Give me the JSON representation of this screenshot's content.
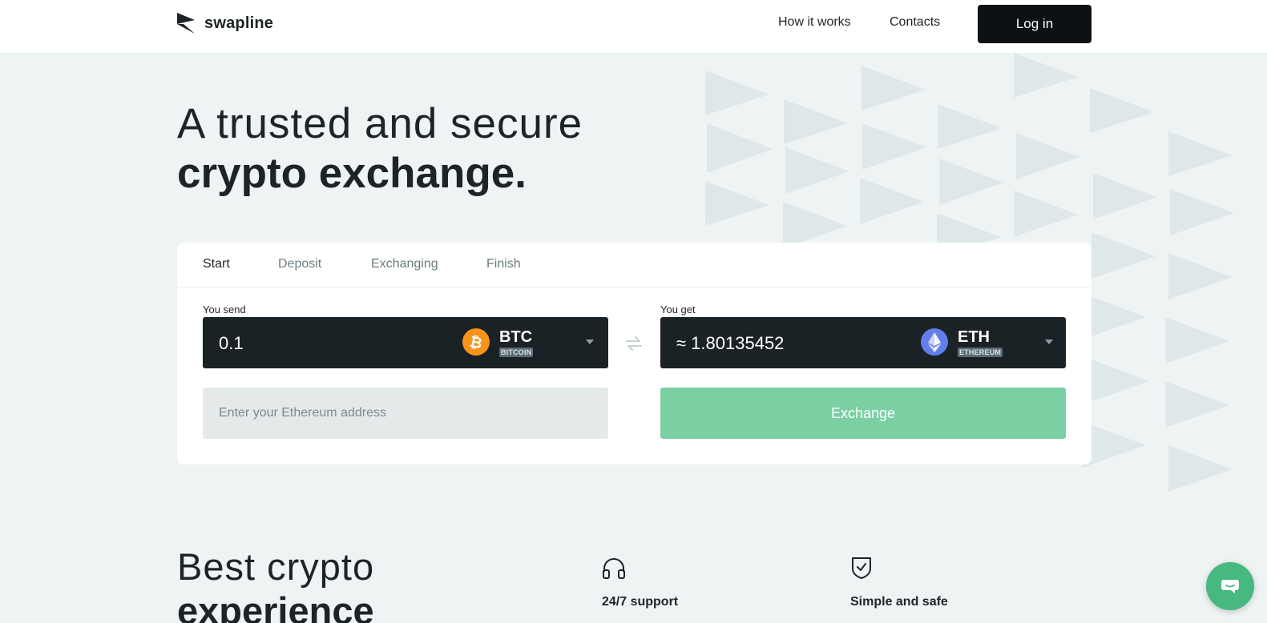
{
  "header": {
    "logo_text": "swapline",
    "nav": [
      {
        "label": "How it works"
      },
      {
        "label": "Contacts"
      }
    ],
    "login_label": "Log in"
  },
  "hero": {
    "line1": "A trusted and secure",
    "line2": "crypto exchange."
  },
  "exchange": {
    "tabs": [
      {
        "label": "Start",
        "active": true
      },
      {
        "label": "Deposit",
        "active": false
      },
      {
        "label": "Exchanging",
        "active": false
      },
      {
        "label": "Finish",
        "active": false
      }
    ],
    "send": {
      "label": "You send",
      "amount": "0.1",
      "ticker": "BTC",
      "coin_name": "BITCOIN",
      "icon": "bitcoin-icon"
    },
    "get": {
      "label": "You get",
      "amount": "≈ 1.80135452",
      "ticker": "ETH",
      "coin_name": "ETHEREUM",
      "icon": "ethereum-icon"
    },
    "address_placeholder": "Enter your Ethereum address",
    "exchange_label": "Exchange"
  },
  "features": {
    "title_line1": "Best crypto",
    "title_line2": "experience",
    "items": [
      {
        "title": "24/7 support",
        "icon": "headphones-icon"
      },
      {
        "title": "Simple and safe",
        "icon": "shield-check-icon"
      }
    ]
  },
  "colors": {
    "background": "#eef3f3",
    "dark": "#0b1114",
    "panel_dark": "#1a2225",
    "accent_green": "#7acfa3",
    "chat_green": "#47b87f",
    "bitcoin": "#f7931a",
    "ethereum": "#627eea"
  }
}
